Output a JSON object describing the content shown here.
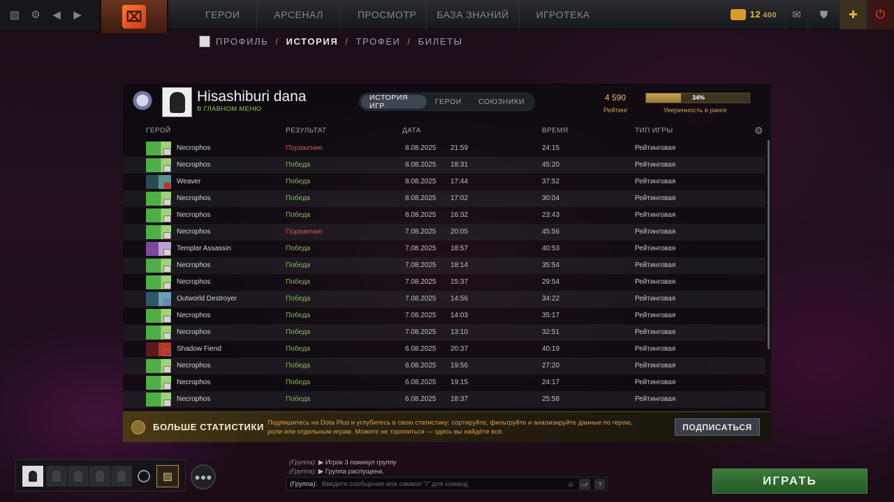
{
  "topbar": {
    "nav": [
      "ГЕРОИ",
      "АРСЕНАЛ",
      "ПРОСМОТР",
      "БАЗА ЗНАНИЙ",
      "ИГРОТЕКА"
    ],
    "currency": {
      "value": "12",
      "sub": "400"
    }
  },
  "subnav": {
    "items": [
      "ПРОФИЛЬ",
      "ИСТОРИЯ",
      "ТРОФЕИ",
      "БИЛЕТЫ"
    ],
    "separator": "/"
  },
  "profile": {
    "name": "Hisashiburi dana",
    "status": "В ГЛАВНОМ МЕНЮ",
    "tabs": [
      "ИСТОРИЯ ИГР",
      "ГЕРОИ",
      "СОЮЗНИКИ"
    ],
    "rating_value": "4 590",
    "rating_label": "Рейтинг",
    "confidence_pct": "34%",
    "confidence_fraction": 0.34,
    "confidence_label": "Уверенность в ранге"
  },
  "table": {
    "headers": {
      "hero": "ГЕРОЙ",
      "result": "РЕЗУЛЬТАТ",
      "date": "ДАТА",
      "duration": "ВРЕМЯ",
      "type": "ТИП ИГРЫ"
    },
    "rows": [
      {
        "hero": "Necrophos",
        "result": "Поражение",
        "date": "8.08.2025",
        "time": "21:59",
        "duration": "24:15",
        "type": "Рейтинговая"
      },
      {
        "hero": "Necrophos",
        "result": "Победа",
        "date": "8.08.2025",
        "time": "18:31",
        "duration": "45:20",
        "type": "Рейтинговая"
      },
      {
        "hero": "Weaver",
        "result": "Победа",
        "date": "8.08.2025",
        "time": "17:44",
        "duration": "37:52",
        "type": "Рейтинговая"
      },
      {
        "hero": "Necrophos",
        "result": "Победа",
        "date": "8.08.2025",
        "time": "17:02",
        "duration": "30:04",
        "type": "Рейтинговая"
      },
      {
        "hero": "Necrophos",
        "result": "Победа",
        "date": "8.08.2025",
        "time": "16:32",
        "duration": "23:43",
        "type": "Рейтинговая"
      },
      {
        "hero": "Necrophos",
        "result": "Поражение",
        "date": "7.08.2025",
        "time": "20:05",
        "duration": "45:56",
        "type": "Рейтинговая"
      },
      {
        "hero": "Templar Assassin",
        "result": "Победа",
        "date": "7.08.2025",
        "time": "18:57",
        "duration": "40:53",
        "type": "Рейтинговая"
      },
      {
        "hero": "Necrophos",
        "result": "Победа",
        "date": "7.08.2025",
        "time": "18:14",
        "duration": "35:54",
        "type": "Рейтинговая"
      },
      {
        "hero": "Necrophos",
        "result": "Победа",
        "date": "7.08.2025",
        "time": "15:37",
        "duration": "29:54",
        "type": "Рейтинговая"
      },
      {
        "hero": "Outworld Destroyer",
        "result": "Победа",
        "date": "7.08.2025",
        "time": "14:56",
        "duration": "34:22",
        "type": "Рейтинговая"
      },
      {
        "hero": "Necrophos",
        "result": "Победа",
        "date": "7.08.2025",
        "time": "14:03",
        "duration": "35:17",
        "type": "Рейтинговая"
      },
      {
        "hero": "Necrophos",
        "result": "Победа",
        "date": "7.08.2025",
        "time": "13:10",
        "duration": "32:51",
        "type": "Рейтинговая"
      },
      {
        "hero": "Shadow Fiend",
        "result": "Победа",
        "date": "6.08.2025",
        "time": "20:37",
        "duration": "40:19",
        "type": "Рейтинговая"
      },
      {
        "hero": "Necrophos",
        "result": "Победа",
        "date": "6.08.2025",
        "time": "19:56",
        "duration": "27:20",
        "type": "Рейтинговая"
      },
      {
        "hero": "Necrophos",
        "result": "Победа",
        "date": "6.08.2025",
        "time": "19:15",
        "duration": "24:17",
        "type": "Рейтинговая"
      },
      {
        "hero": "Necrophos",
        "result": "Победа",
        "date": "6.08.2025",
        "time": "18:37",
        "duration": "25:58",
        "type": "Рейтинговая"
      }
    ]
  },
  "banner": {
    "title": "БОЛЬШЕ СТАТИСТИКИ",
    "text": "Подпишитесь на Dota Plus и углубитесь в свою статистику: сортируйте, фильтруйте и анализируйте данные по герою, роли или отдельным играм. Можете не торопиться — здесь вы найдёте всё.",
    "button": "ПОДПИСАТЬСЯ"
  },
  "chat": {
    "lines": [
      {
        "group": "(Группа):",
        "text": "▶ Игрок 3 покинул группу"
      },
      {
        "group": "(Группа):",
        "text": "▶ Группа распущена."
      }
    ],
    "input_label": "(Группа):",
    "placeholder": "Введите сообщение или символ \"/\" для команд."
  },
  "play_button": "ИГРАТЬ",
  "colors": {
    "win": "#7cc24a",
    "loss": "#e0503a",
    "accent": "#c8a050"
  }
}
